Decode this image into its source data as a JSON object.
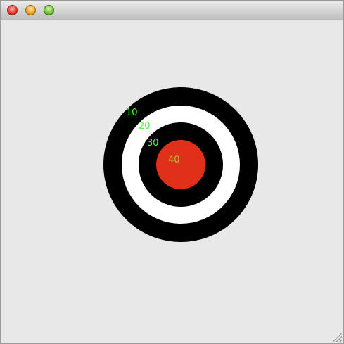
{
  "window": {
    "buttons": [
      {
        "name": "close",
        "color": "#e2362a"
      },
      {
        "name": "minimize",
        "color": "#f0a21e"
      },
      {
        "name": "zoom",
        "color": "#6cc233"
      }
    ]
  },
  "target": {
    "rings": [
      {
        "score": "10",
        "color": "#000000"
      },
      {
        "score": "20",
        "color": "#ffffff"
      },
      {
        "score": "30",
        "color": "#000000"
      },
      {
        "score": "40",
        "color": "#e0301a"
      }
    ],
    "label_color": "#44ff33"
  }
}
